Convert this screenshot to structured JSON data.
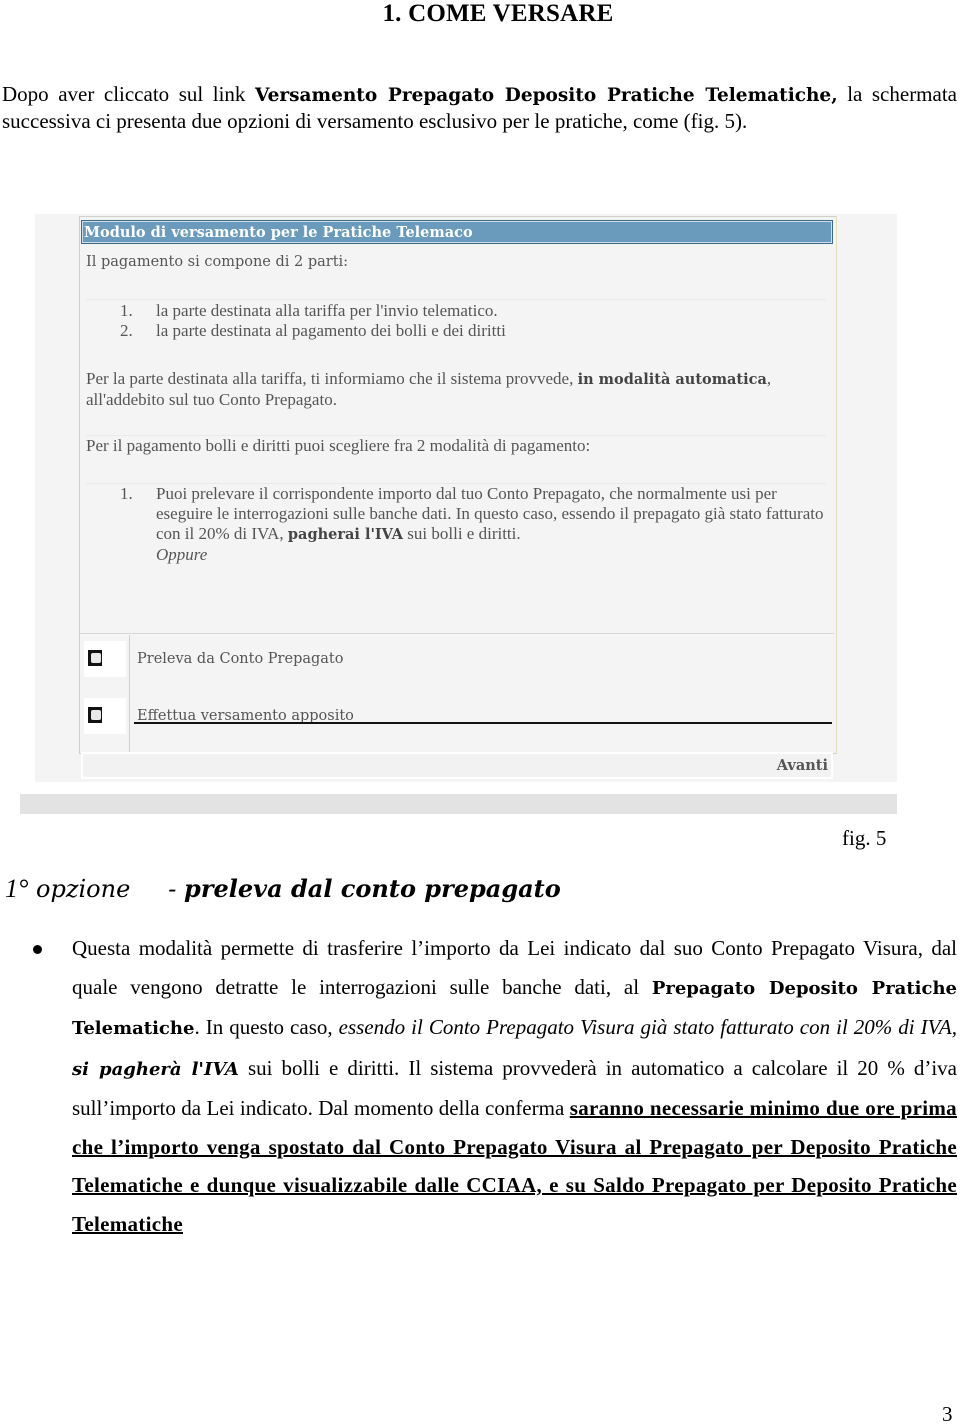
{
  "section_title": "1. COME VERSARE",
  "intro": {
    "before": "Dopo aver cliccato sul link ",
    "bold": "Versamento Prepagato Deposito Pratiche Telematiche,",
    "after": " la schermata successiva ci presenta due opzioni di versamento esclusivo per le pratiche, come (fig. 5)."
  },
  "figure": {
    "panel_title": "Modulo di versamento per le Pratiche Telemaco",
    "parts_intro": "Il pagamento si compone di 2 parti:",
    "parts": [
      {
        "num": "1.",
        "text": "la parte destinata alla tariffa per l'invio telematico."
      },
      {
        "num": "2.",
        "text": "la parte destinata al pagamento dei bolli e dei diritti"
      }
    ],
    "tariff_note": {
      "before": "Per la parte destinata alla tariffa, ti informiamo che il sistema provvede, ",
      "bold": "in modalità automatica",
      "after": ", all'addebito sul tuo Conto Prepagato."
    },
    "modes_intro": "Per il pagamento bolli e diritti puoi scegliere fra 2 modalità di pagamento:",
    "mode_item": {
      "num": "1.",
      "before": "Puoi prelevare il corrispondente importo dal tuo Conto Prepagato, che normalmente usi per eseguire le interrogazioni sulle banche dati. In questo caso, essendo il prepagato già stato fatturato con il 20% di IVA, ",
      "bold": "pagherai l'IVA",
      "after": " sui bolli e diritti.",
      "oppure": "Oppure"
    },
    "options": [
      {
        "label": "Preleva da Conto Prepagato",
        "selected": false
      },
      {
        "label": "Effettua versamento apposito",
        "selected": false
      }
    ],
    "next_button": "Avanti"
  },
  "figure_caption": "fig. 5",
  "option_heading": {
    "prefix": "1°",
    "word": "opzione",
    "dash": "-",
    "title": "preleva dal conto prepagato"
  },
  "body": {
    "t1": "Questa modalità permette di  trasferire l’importo da Lei indicato dal suo Conto Prepagato Visura, dal quale vengono detratte le interrogazioni sulle banche dati, al ",
    "b1": "Prepagato Deposito Pratiche Telematiche",
    "t2": ". In questo caso, ",
    "i1": "essendo il Conto Prepagato Visura già stato fatturato con il 20% di IVA, ",
    "bi1": "si pagherà l'IVA",
    "t3": " sui bolli e diritti. Il sistema provvederà in automatico a calcolare il 20 % d’iva sull’importo da Lei indicato. Dal momento della conferma ",
    "bu1": "saranno necessarie minimo due ore prima che l’importo venga spostato  dal Conto Prepagato Visura al Prepagato per Deposito Pratiche Telematiche e dunque visualizzabile dalle CCIAA, e su Saldo  Prepagato per Deposito Pratiche Telematiche"
  },
  "page_number": "3"
}
